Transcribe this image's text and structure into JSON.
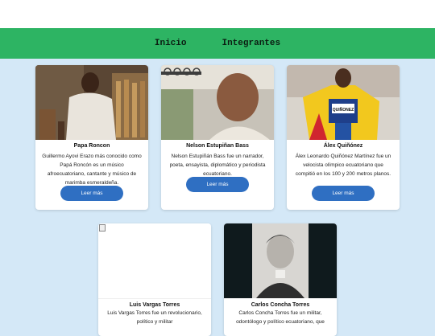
{
  "nav": {
    "items": [
      "Inicio",
      "Integrantes"
    ]
  },
  "cards": [
    {
      "name": "Papa Roncon",
      "description": "Guillermo Ayovi Erazo más conocido como Papá Roncón es un músico afroecuatoriano, cantante y músico de marimba esmeraldeña.",
      "button": "Leer más"
    },
    {
      "name": "Nelson Estupiñan Bass",
      "description": "Nelson Estupiñán Bass  fue un narrador, poeta, ensayista, diplomático y periodista ecuatoriano.",
      "button": "Leer más"
    },
    {
      "name": "Álex Quiñónez",
      "description": "Álex Leonardo Quiñónez Martínez  fue un velocista olímpico ecuatoriano que compitió en los 100 y 200 metros planos.",
      "button": "Leer más",
      "bib_text": "QUIÑONEZ"
    },
    {
      "name": "Luis Vargas Torres",
      "description": "Luis Vargas Torres fue un revolucionario, político y militar"
    },
    {
      "name": "Carlos Concha Torres",
      "description": "Carlos Concha Torres fue un militar, odontólogo y político ecuatoriano, que"
    }
  ]
}
